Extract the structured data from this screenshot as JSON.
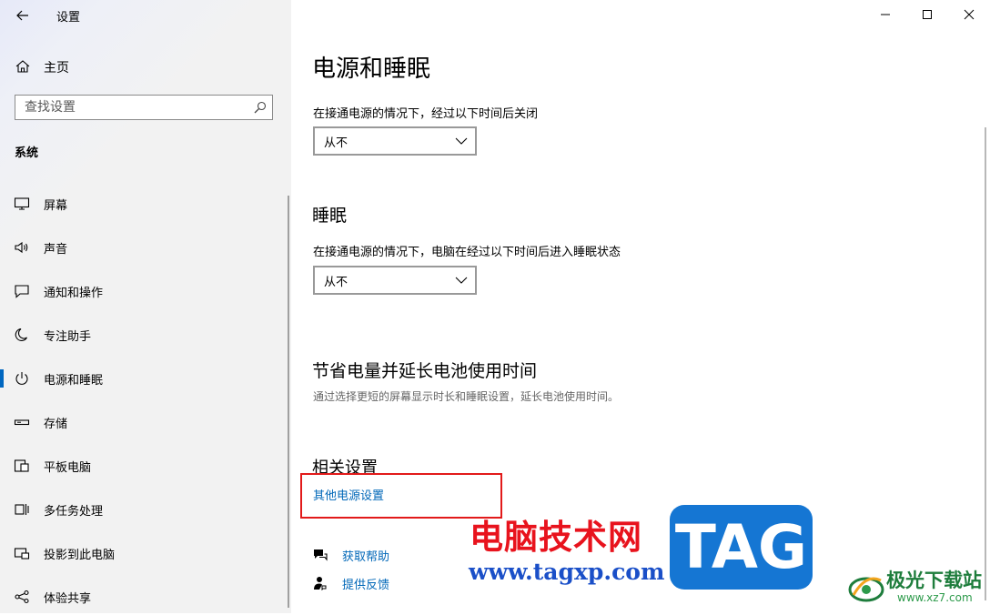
{
  "app": {
    "title": "设置"
  },
  "sidebar": {
    "home_label": "主页",
    "search_placeholder": "查找设置",
    "section_header": "系统",
    "items": [
      {
        "label": "屏幕",
        "icon": "display-icon"
      },
      {
        "label": "声音",
        "icon": "speaker-icon"
      },
      {
        "label": "通知和操作",
        "icon": "notification-icon"
      },
      {
        "label": "专注助手",
        "icon": "moon-icon"
      },
      {
        "label": "电源和睡眠",
        "icon": "power-icon",
        "active": true
      },
      {
        "label": "存储",
        "icon": "storage-icon"
      },
      {
        "label": "平板电脑",
        "icon": "tablet-icon"
      },
      {
        "label": "多任务处理",
        "icon": "multitask-icon"
      },
      {
        "label": "投影到此电脑",
        "icon": "project-icon"
      },
      {
        "label": "体验共享",
        "icon": "share-icon"
      }
    ]
  },
  "main": {
    "title": "电源和睡眠",
    "screen_label": "在接通电源的情况下，经过以下时间后关闭",
    "screen_value": "从不",
    "sleep_heading": "睡眠",
    "sleep_label": "在接通电源的情况下，电脑在经过以下时间后进入睡眠状态",
    "sleep_value": "从不",
    "battery_heading": "节省电量并延长电池使用时间",
    "battery_desc": "通过选择更短的屏幕显示时长和睡眠设置，延长电池使用时间。",
    "related_heading": "相关设置",
    "related_link": "其他电源设置",
    "help_label": "获取帮助",
    "feedback_label": "提供反馈"
  },
  "watermark": {
    "cn_text": "电脑技术网",
    "url": "www.tagxp.com",
    "tag": "TAG",
    "site_name": "极光下载站",
    "site_url": "www.xz7.com"
  },
  "colors": {
    "accent": "#0067c0",
    "link": "#0067b8",
    "highlight": "#e21a1a",
    "sidebar_bg": "#f2f2f2"
  }
}
